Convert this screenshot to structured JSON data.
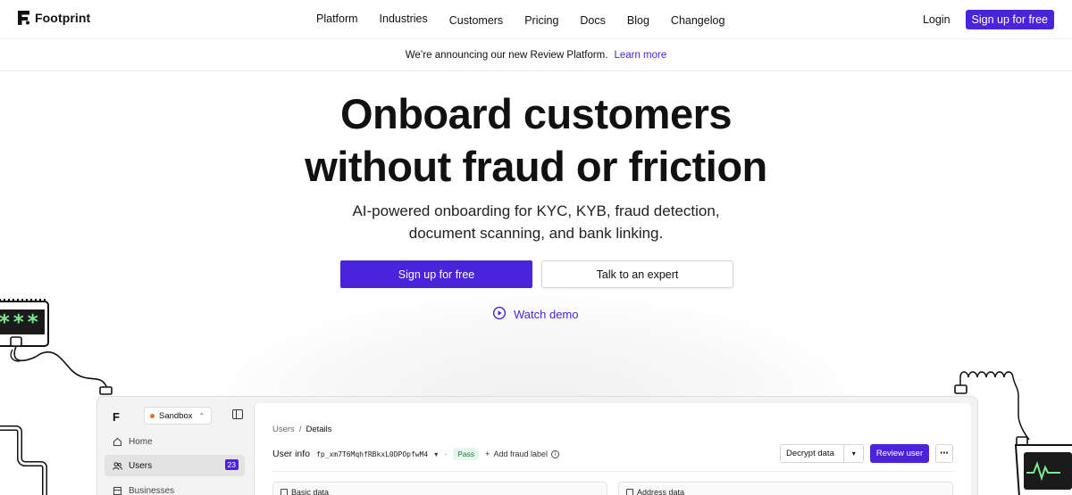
{
  "brand": {
    "name": "Footprint",
    "accent": "#4a24db"
  },
  "nav": {
    "links": [
      "Platform",
      "Industries",
      "Customers",
      "Pricing",
      "Docs",
      "Blog",
      "Changelog"
    ],
    "login": "Login",
    "signup": "Sign up for free"
  },
  "banner": {
    "text": "We’re announcing our new Review Platform.",
    "link": "Learn more"
  },
  "hero": {
    "headline_line1": "Onboard customers",
    "headline_line2": "without fraud or friction",
    "sub_line1": "AI-powered onboarding for KYC, KYB, fraud detection,",
    "sub_line2": "document scanning, and bank linking.",
    "cta_primary": "Sign up for free",
    "cta_secondary": "Talk to an expert",
    "watch_demo": "Watch demo"
  },
  "doodle": {
    "password_mask": "***"
  },
  "dashboard": {
    "logo": "F",
    "environment": "Sandbox",
    "sidebar": [
      {
        "label": "Home",
        "icon": "home-icon"
      },
      {
        "label": "Users",
        "icon": "users-icon",
        "count": "23",
        "active": true
      },
      {
        "label": "Businesses",
        "icon": "building-icon"
      }
    ],
    "breadcrumb": {
      "parent": "Users",
      "separator": "/",
      "current": "Details"
    },
    "user_info_label": "User info",
    "user_id": "fp_xm7T6MqhfRBkxL0DPOpfwM4",
    "status": "Pass",
    "add_fraud_label": "Add fraud label",
    "decrypt_label": "Decrypt data",
    "review_label": "Review user",
    "cards": {
      "left": "Basic data",
      "right": "Address data"
    }
  }
}
